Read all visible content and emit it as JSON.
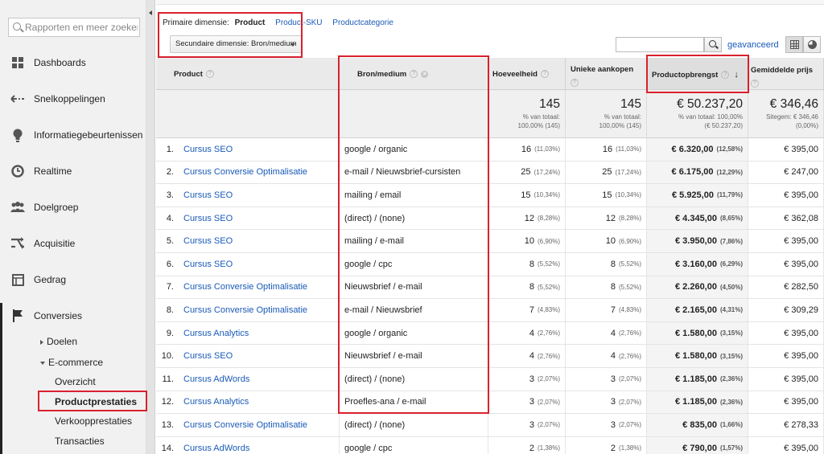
{
  "sidebar": {
    "search_placeholder": "Rapporten en meer zoeken",
    "items": [
      {
        "label": "Dashboards",
        "icon": "dashboard-grid-icon"
      },
      {
        "label": "Snelkoppelingen",
        "icon": "shortcut-arrows-icon"
      },
      {
        "label": "Informatiegebeurtenissen",
        "icon": "lightbulb-icon"
      },
      {
        "label": "Realtime",
        "icon": "clock-icon"
      },
      {
        "label": "Doelgroep",
        "icon": "people-icon"
      },
      {
        "label": "Acquisitie",
        "icon": "acquisition-arrows-icon"
      },
      {
        "label": "Gedrag",
        "icon": "behavior-window-icon"
      },
      {
        "label": "Conversies",
        "icon": "flag-icon"
      }
    ],
    "conversies_sub": {
      "doelen": "Doelen",
      "ecommerce": "E-commerce",
      "ecommerce_items": [
        "Overzicht",
        "Productprestaties",
        "Verkoopprestaties",
        "Transacties"
      ]
    }
  },
  "dimensions": {
    "primary_label": "Primaire dimensie:",
    "primary_active": "Product",
    "links": [
      "Product-SKU",
      "Productcategorie"
    ],
    "secondary": "Secundaire dimensie: Bron/medium"
  },
  "toolbar": {
    "search_value": "",
    "advanced": "geavanceerd"
  },
  "table": {
    "headers": {
      "product": "Product",
      "source": "Bron/medium",
      "qty": "Hoeveelheid",
      "unique": "Unieke aankopen",
      "revenue": "Productopbrengst",
      "avgprice": "Gemiddelde prijs"
    },
    "totals": {
      "qty": {
        "value": "145",
        "l1": "% van totaal:",
        "l2": "100,00% (145)"
      },
      "unique": {
        "value": "145",
        "l1": "% van totaal:",
        "l2": "100,00% (145)"
      },
      "revenue": {
        "value": "€ 50.237,20",
        "l1": "% van totaal: 100,00%",
        "l2": "(€ 50.237,20)"
      },
      "avgprice": {
        "value": "€ 346,46",
        "l1": "Sitegem: € 346,46",
        "l2": "(0,00%)"
      }
    },
    "rows": [
      {
        "n": "1.",
        "product": "Cursus SEO",
        "source": "google / organic",
        "qty": "16",
        "qty_pct": "(11,03%)",
        "uniq": "16",
        "uniq_pct": "(11,03%)",
        "rev": "€ 6.320,00",
        "rev_pct": "(12,58%)",
        "avg": "€ 395,00"
      },
      {
        "n": "2.",
        "product": "Cursus Conversie Optimalisatie",
        "source": "e-mail / Nieuwsbrief-cursisten",
        "qty": "25",
        "qty_pct": "(17,24%)",
        "uniq": "25",
        "uniq_pct": "(17,24%)",
        "rev": "€ 6.175,00",
        "rev_pct": "(12,29%)",
        "avg": "€ 247,00"
      },
      {
        "n": "3.",
        "product": "Cursus SEO",
        "source": "mailing / email",
        "qty": "15",
        "qty_pct": "(10,34%)",
        "uniq": "15",
        "uniq_pct": "(10,34%)",
        "rev": "€ 5.925,00",
        "rev_pct": "(11,79%)",
        "avg": "€ 395,00"
      },
      {
        "n": "4.",
        "product": "Cursus SEO",
        "source": "(direct) / (none)",
        "qty": "12",
        "qty_pct": "(8,28%)",
        "uniq": "12",
        "uniq_pct": "(8,28%)",
        "rev": "€ 4.345,00",
        "rev_pct": "(8,65%)",
        "avg": "€ 362,08"
      },
      {
        "n": "5.",
        "product": "Cursus SEO",
        "source": "mailing / e-mail",
        "qty": "10",
        "qty_pct": "(6,90%)",
        "uniq": "10",
        "uniq_pct": "(6,90%)",
        "rev": "€ 3.950,00",
        "rev_pct": "(7,86%)",
        "avg": "€ 395,00"
      },
      {
        "n": "6.",
        "product": "Cursus SEO",
        "source": "google / cpc",
        "qty": "8",
        "qty_pct": "(5,52%)",
        "uniq": "8",
        "uniq_pct": "(5,52%)",
        "rev": "€ 3.160,00",
        "rev_pct": "(6,29%)",
        "avg": "€ 395,00"
      },
      {
        "n": "7.",
        "product": "Cursus Conversie Optimalisatie",
        "source": "Nieuwsbrief / e-mail",
        "qty": "8",
        "qty_pct": "(5,52%)",
        "uniq": "8",
        "uniq_pct": "(5,52%)",
        "rev": "€ 2.260,00",
        "rev_pct": "(4,50%)",
        "avg": "€ 282,50"
      },
      {
        "n": "8.",
        "product": "Cursus Conversie Optimalisatie",
        "source": "e-mail / Nieuwsbrief",
        "qty": "7",
        "qty_pct": "(4,83%)",
        "uniq": "7",
        "uniq_pct": "(4,83%)",
        "rev": "€ 2.165,00",
        "rev_pct": "(4,31%)",
        "avg": "€ 309,29"
      },
      {
        "n": "9.",
        "product": "Cursus Analytics",
        "source": "google / organic",
        "qty": "4",
        "qty_pct": "(2,76%)",
        "uniq": "4",
        "uniq_pct": "(2,76%)",
        "rev": "€ 1.580,00",
        "rev_pct": "(3,15%)",
        "avg": "€ 395,00"
      },
      {
        "n": "10.",
        "product": "Cursus SEO",
        "source": "Nieuwsbrief / e-mail",
        "qty": "4",
        "qty_pct": "(2,76%)",
        "uniq": "4",
        "uniq_pct": "(2,76%)",
        "rev": "€ 1.580,00",
        "rev_pct": "(3,15%)",
        "avg": "€ 395,00"
      },
      {
        "n": "11.",
        "product": "Cursus AdWords",
        "source": "(direct) / (none)",
        "qty": "3",
        "qty_pct": "(2,07%)",
        "uniq": "3",
        "uniq_pct": "(2,07%)",
        "rev": "€ 1.185,00",
        "rev_pct": "(2,36%)",
        "avg": "€ 395,00"
      },
      {
        "n": "12.",
        "product": "Cursus Analytics",
        "source": "Proefles-ana / e-mail",
        "qty": "3",
        "qty_pct": "(2,07%)",
        "uniq": "3",
        "uniq_pct": "(2,07%)",
        "rev": "€ 1.185,00",
        "rev_pct": "(2,36%)",
        "avg": "€ 395,00"
      },
      {
        "n": "13.",
        "product": "Cursus Conversie Optimalisatie",
        "source": "(direct) / (none)",
        "qty": "3",
        "qty_pct": "(2,07%)",
        "uniq": "3",
        "uniq_pct": "(2,07%)",
        "rev": "€ 835,00",
        "rev_pct": "(1,66%)",
        "avg": "€ 278,33"
      },
      {
        "n": "14.",
        "product": "Cursus AdWords",
        "source": "google / cpc",
        "qty": "2",
        "qty_pct": "(1,38%)",
        "uniq": "2",
        "uniq_pct": "(1,38%)",
        "rev": "€ 790,00",
        "rev_pct": "(1,57%)",
        "avg": "€ 395,00"
      }
    ]
  },
  "colors": {
    "link": "#1a5ab8",
    "highlight": "#d9212d",
    "header_bg": "#eaeaea"
  }
}
